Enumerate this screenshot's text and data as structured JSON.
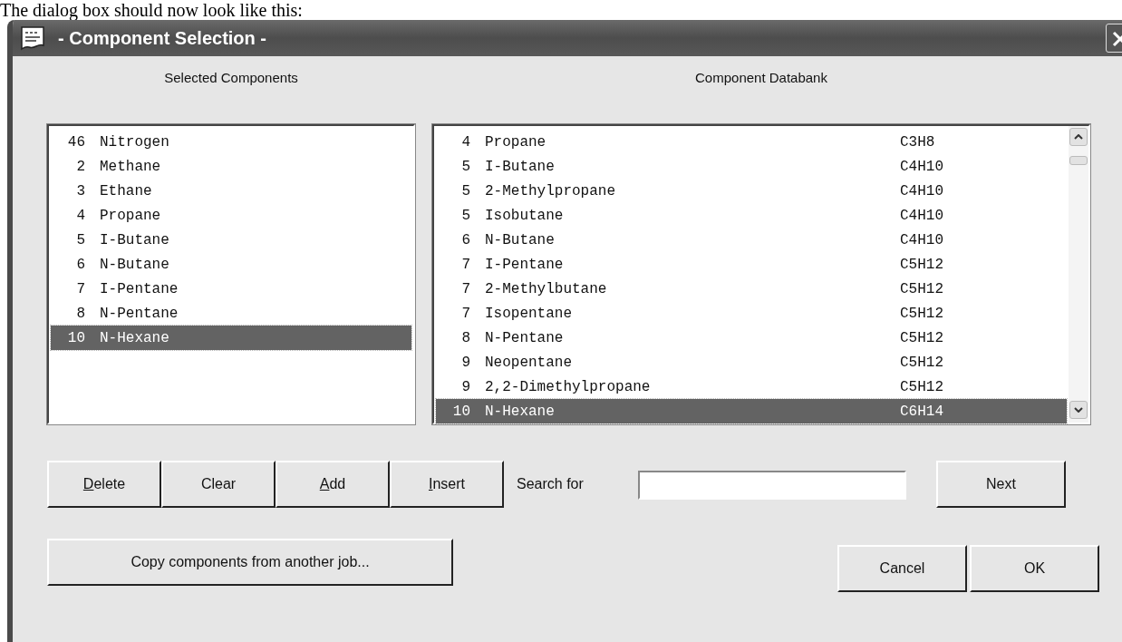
{
  "caption": "The dialog box should now look like this:",
  "window": {
    "title": "- Component Selection -"
  },
  "selected_components": {
    "label": "Selected Components",
    "items": [
      {
        "number": "46",
        "name": "Nitrogen",
        "selected": false
      },
      {
        "number": "2",
        "name": "Methane",
        "selected": false
      },
      {
        "number": "3",
        "name": "Ethane",
        "selected": false
      },
      {
        "number": "4",
        "name": "Propane",
        "selected": false
      },
      {
        "number": "5",
        "name": "I-Butane",
        "selected": false
      },
      {
        "number": "6",
        "name": "N-Butane",
        "selected": false
      },
      {
        "number": "7",
        "name": "I-Pentane",
        "selected": false
      },
      {
        "number": "8",
        "name": "N-Pentane",
        "selected": false
      },
      {
        "number": "10",
        "name": "N-Hexane",
        "selected": true
      }
    ]
  },
  "component_databank": {
    "label": "Component Databank",
    "items": [
      {
        "number": "4",
        "name": "Propane",
        "formula": "C3H8",
        "selected": false
      },
      {
        "number": "5",
        "name": "I-Butane",
        "formula": "C4H10",
        "selected": false
      },
      {
        "number": "5",
        "name": "2-Methylpropane",
        "formula": "C4H10",
        "selected": false
      },
      {
        "number": "5",
        "name": "Isobutane",
        "formula": "C4H10",
        "selected": false
      },
      {
        "number": "6",
        "name": "N-Butane",
        "formula": "C4H10",
        "selected": false
      },
      {
        "number": "7",
        "name": "I-Pentane",
        "formula": "C5H12",
        "selected": false
      },
      {
        "number": "7",
        "name": "2-Methylbutane",
        "formula": "C5H12",
        "selected": false
      },
      {
        "number": "7",
        "name": "Isopentane",
        "formula": "C5H12",
        "selected": false
      },
      {
        "number": "8",
        "name": "N-Pentane",
        "formula": "C5H12",
        "selected": false
      },
      {
        "number": "9",
        "name": "Neopentane",
        "formula": "C5H12",
        "selected": false
      },
      {
        "number": "9",
        "name": "2,2-Dimethylpropane",
        "formula": "C5H12",
        "selected": false
      },
      {
        "number": "10",
        "name": "N-Hexane",
        "formula": "C6H14",
        "selected": true
      }
    ]
  },
  "list_buttons": [
    {
      "label": "Delete",
      "underlined_first_letter": true
    },
    {
      "label": "Clear",
      "underlined_first_letter": false
    },
    {
      "label": "Add",
      "underlined_first_letter": true
    },
    {
      "label": "Insert",
      "underlined_first_letter": true
    }
  ],
  "search": {
    "label": "Search for",
    "next_button": "Next"
  },
  "copy_button": "Copy components from another job...",
  "buttons": [
    "Cancel",
    "OK"
  ]
}
